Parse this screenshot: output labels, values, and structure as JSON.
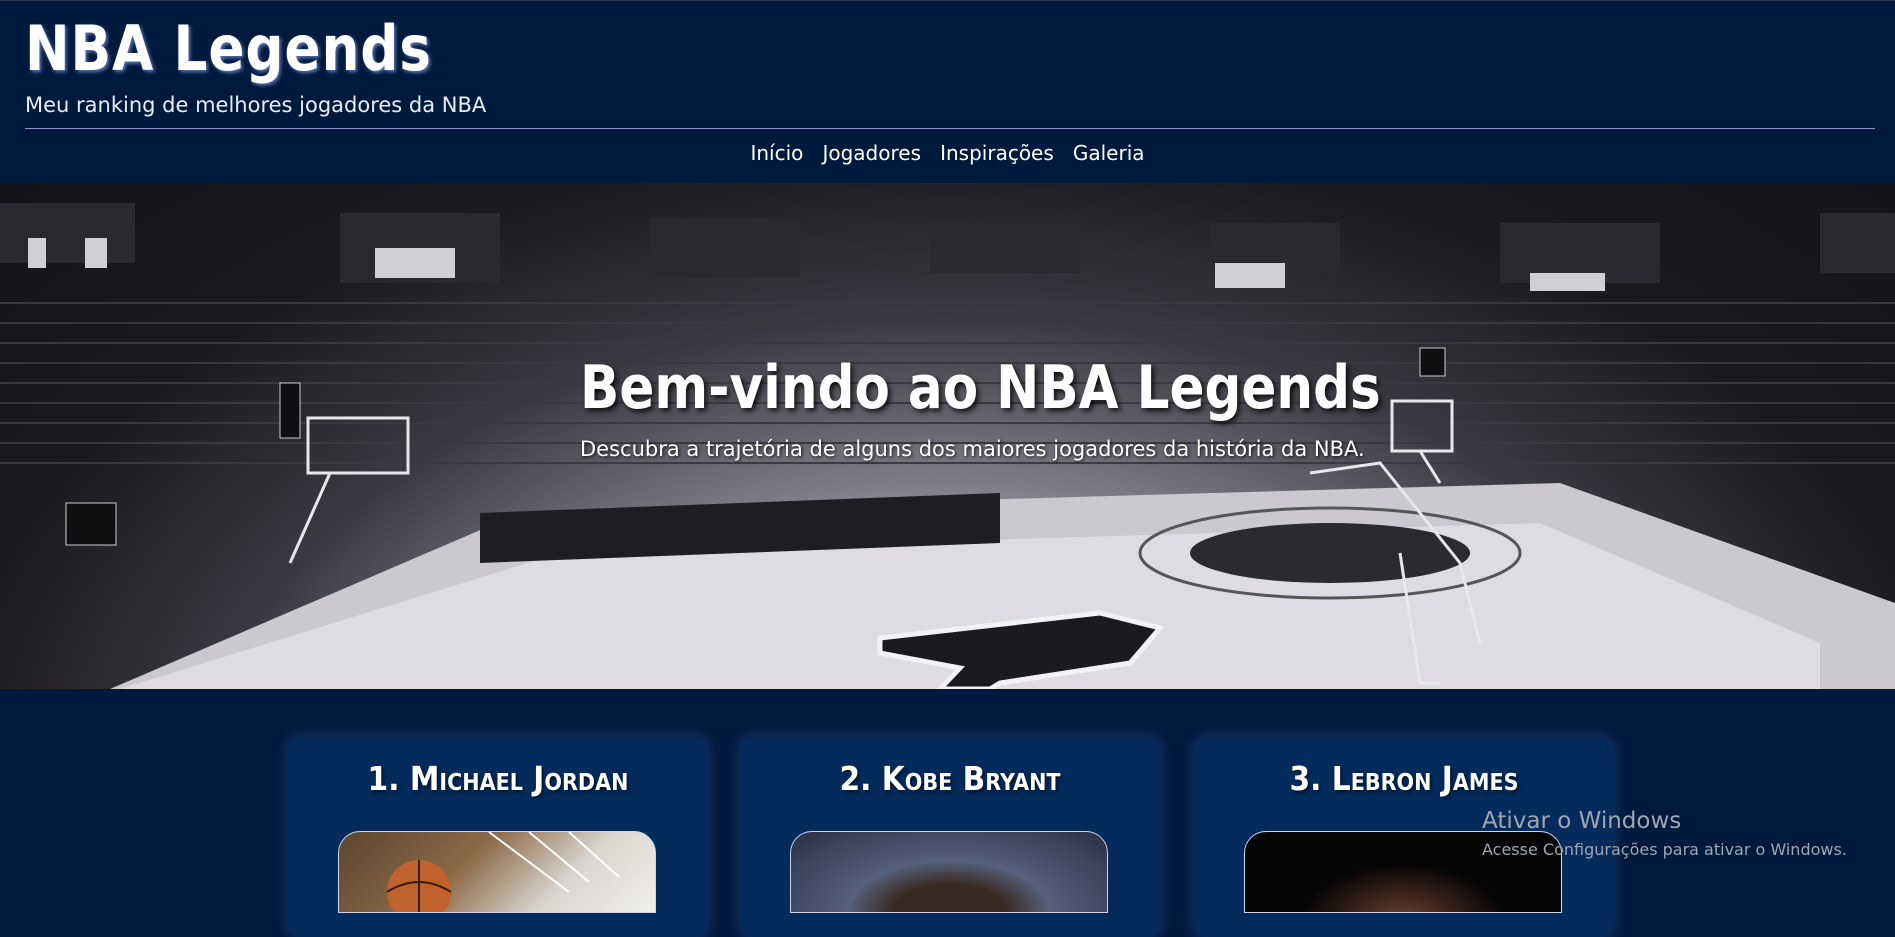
{
  "header": {
    "logo": "NBA Legends",
    "tagline": "Meu ranking de melhores jogadores da NBA"
  },
  "nav": {
    "items": [
      {
        "label": "Início"
      },
      {
        "label": "Jogadores"
      },
      {
        "label": "Inspirações"
      },
      {
        "label": "Galeria"
      }
    ]
  },
  "hero": {
    "title": "Bem-vindo ao NBA Legends",
    "subtitle": "Descubra a trajetória de alguns dos maiores jogadores da história da NBA."
  },
  "players": [
    {
      "title": "1. Michael Jordan"
    },
    {
      "title": "2. Kobe Bryant"
    },
    {
      "title": "3. Lebron James"
    }
  ],
  "watermark": {
    "line1": "Ativar o Windows",
    "line2": "Acesse Configurações para ativar o Windows."
  },
  "colors": {
    "page_bg": "#001a3d",
    "card_bg": "#052a5c",
    "text": "#ffffff"
  }
}
